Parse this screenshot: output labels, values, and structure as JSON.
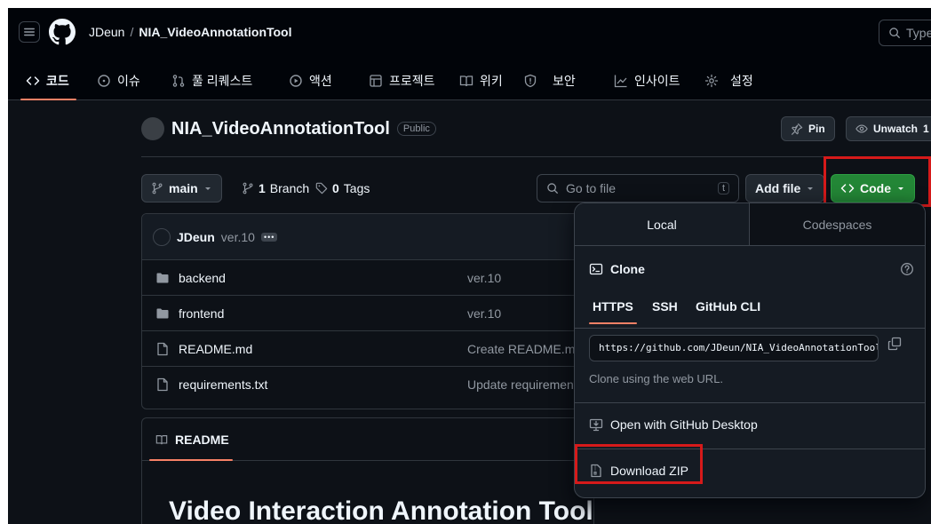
{
  "header": {
    "owner": "JDeun",
    "separator": "/",
    "repo": "NIA_VideoAnnotationTool",
    "search_placeholder": "Type"
  },
  "nav_tabs": [
    {
      "label": "코드",
      "icon": "code-icon",
      "active": true
    },
    {
      "label": "이슈",
      "icon": "issue-icon"
    },
    {
      "label": "풀 리퀘스트",
      "icon": "pull-request-icon"
    },
    {
      "label": "액션",
      "icon": "play-icon"
    },
    {
      "label": "프로젝트",
      "icon": "table-icon"
    },
    {
      "label": "위키",
      "icon": "book-icon"
    },
    {
      "label": "보안",
      "icon": "shield-icon"
    },
    {
      "label": "인사이트",
      "icon": "graph-icon"
    },
    {
      "label": "설정",
      "icon": "gear-icon"
    }
  ],
  "repo_header": {
    "title": "NIA_VideoAnnotationTool",
    "visibility": "Public",
    "pin_label": "Pin",
    "unwatch_label": "Unwatch",
    "unwatch_count": "1"
  },
  "toolbar": {
    "branch": "main",
    "branch_count": "1",
    "branch_label": "Branch",
    "tag_count": "0",
    "tag_label": "Tags",
    "goto_placeholder": "Go to file",
    "goto_key": "t",
    "add_file_label": "Add file",
    "code_label": "Code"
  },
  "latest_commit": {
    "author": "JDeun",
    "message": "ver.10",
    "more": "•••"
  },
  "files": [
    {
      "name": "backend",
      "type": "folder",
      "message": "ver.10"
    },
    {
      "name": "frontend",
      "type": "folder",
      "message": "ver.10"
    },
    {
      "name": "README.md",
      "type": "file",
      "message": "Create README.md"
    },
    {
      "name": "requirements.txt",
      "type": "file",
      "message": "Update requiremen"
    }
  ],
  "readme": {
    "tab_label": "README",
    "heading": "Video Interaction Annotation Tool"
  },
  "clone_popover": {
    "tabs": [
      "Local",
      "Codespaces"
    ],
    "clone_title": "Clone",
    "protocols": [
      "HTTPS",
      "SSH",
      "GitHub CLI"
    ],
    "url": "https://github.com/JDeun/NIA_VideoAnnotationTool.git",
    "hint": "Clone using the web URL.",
    "open_desktop": "Open with GitHub Desktop",
    "download_zip": "Download ZIP"
  },
  "colors": {
    "background": "#0d1117",
    "header_bg": "#010409",
    "accent_underline": "#f78166",
    "code_button": "#238636",
    "highlight_box": "#d61a1a"
  }
}
